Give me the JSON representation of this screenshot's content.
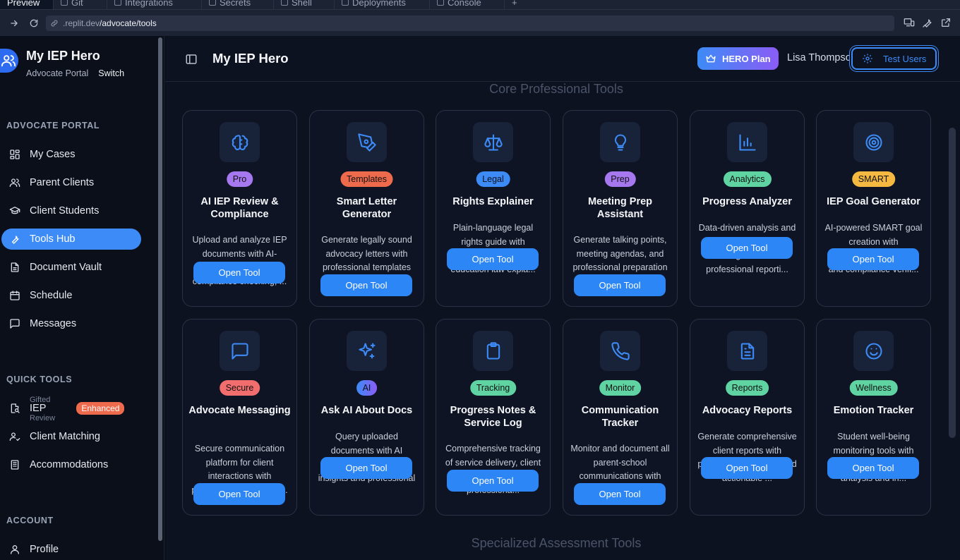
{
  "browser": {
    "tabs": [
      {
        "label": "Preview"
      },
      {
        "label": "Git"
      },
      {
        "label": "Integrations"
      },
      {
        "label": "Secrets"
      },
      {
        "label": "Shell"
      },
      {
        "label": "Deployments"
      },
      {
        "label": "Console"
      },
      {
        "label": "+"
      }
    ],
    "url_host": ".replit.dev",
    "url_path": "/advocate/tools"
  },
  "sidebar": {
    "app_title": "My IEP Hero",
    "portal_label": "Advocate Portal",
    "switch_label": "Switch",
    "section_advocate": "ADVOCATE PORTAL",
    "nav": [
      {
        "label": "My Cases",
        "icon": "grid-icon"
      },
      {
        "label": "Parent Clients",
        "icon": "users-icon"
      },
      {
        "label": "Client Students",
        "icon": "graduation-cap-icon"
      },
      {
        "label": "Tools Hub",
        "icon": "wrench-icon"
      },
      {
        "label": "Document Vault",
        "icon": "document-icon"
      },
      {
        "label": "Schedule",
        "icon": "calendar-icon"
      },
      {
        "label": "Messages",
        "icon": "message-icon"
      }
    ],
    "section_quick": "QUICK TOOLS",
    "quick": [
      {
        "label": "IEP",
        "ghost_top": "Gifted",
        "ghost_bottom": "Review",
        "badge": "Enhanced"
      },
      {
        "label": "Client Matching"
      },
      {
        "label": "Accommodations"
      }
    ],
    "section_account": "ACCOUNT",
    "account": [
      {
        "label": "Profile"
      }
    ]
  },
  "header": {
    "title": "My IEP Hero",
    "plan_label": "HERO Plan",
    "user_name": "Lisa Thompson",
    "test_users_label": "Test Users"
  },
  "sections": {
    "core": "Core Professional Tools",
    "specialized": "Specialized Assessment Tools"
  },
  "open_label": "Open Tool",
  "tools": [
    {
      "tag": "Pro",
      "title": "AI IEP Review & Compliance",
      "desc": "Upload and analyze IEP documents with AI-powered insights, compliance checking, ...",
      "icon": "brain-icon",
      "tag_color": "#a678f0"
    },
    {
      "tag": "Templates",
      "title": "Smart Letter Generator",
      "desc": "Generate legally sound advocacy letters with professional templates and customiz...",
      "icon": "pen-tool-icon",
      "tag_color": "#ee6a4c"
    },
    {
      "tag": "Legal",
      "title": "Rights Explainer",
      "desc": "Plain-language legal rights guide with comprehensive special education law expla...",
      "icon": "scale-icon",
      "tag_color": "#3d8bf7"
    },
    {
      "tag": "Prep",
      "title": "Meeting Prep Assistant",
      "desc": "Generate talking points, meeting agendas, and professional preparation materials...",
      "icon": "lightbulb-icon",
      "tag_color": "#a678f0"
    },
    {
      "tag": "Analytics",
      "title": "Progress Analyzer",
      "desc": "Data-driven analysis and recommendations for IEP goals with professional reporti...",
      "icon": "bar-chart-icon",
      "tag_color": "#5fd3a2"
    },
    {
      "tag": "SMART",
      "title": "IEP Goal Generator",
      "desc": "AI-powered SMART goal creation with professional standards and compliance verifi...",
      "icon": "target-icon",
      "tag_color": "#f5b942"
    },
    {
      "tag": "Secure",
      "title": "Advocate Messaging",
      "desc": "Secure communication platform for client interactions with professional document...",
      "icon": "message-square-icon",
      "tag_color": "#f26d6d"
    },
    {
      "tag": "AI",
      "title": "Ask AI About Docs",
      "desc": "Query uploaded documents with AI assistance for quick insights and professional ...",
      "icon": "sparkles-icon",
      "tag_color": "#3d8bf7"
    },
    {
      "tag": "Tracking",
      "title": "Progress Notes & Service Log",
      "desc": "Comprehensive tracking of service delivery, client interactions, and professiona...",
      "icon": "clipboard-icon",
      "tag_color": "#5fd3a2"
    },
    {
      "tag": "Monitor",
      "title": "Communication Tracker",
      "desc": "Monitor and document all parent-school communications with professional analysis...",
      "icon": "phone-icon",
      "tag_color": "#5fd3a2"
    },
    {
      "tag": "Reports",
      "title": "Advocacy Reports",
      "desc": "Generate comprehensive client reports with professional analysis and actionable ...",
      "icon": "file-text-icon",
      "tag_color": "#5fd3a2"
    },
    {
      "tag": "Wellness",
      "title": "Emotion Tracker",
      "desc": "Student well-being monitoring tools with professional behavioral analysis and in...",
      "icon": "smile-icon",
      "tag_color": "#5fd3a2"
    }
  ],
  "colors": {
    "accent": "#3d8bf7",
    "background": "#0d1220",
    "card": "#0e1423"
  }
}
